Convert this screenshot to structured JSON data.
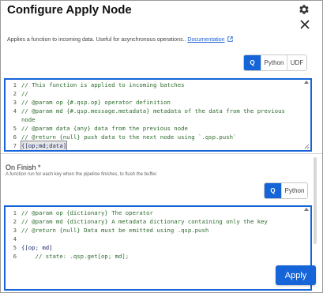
{
  "dialog": {
    "title": "Configure Apply Node",
    "description": "Applies a function to incoming data. Useful for asynchronous operations..",
    "doc_link": "Documentation"
  },
  "languages_top": [
    "Q",
    "Python",
    "UDF"
  ],
  "editor_top": {
    "lines": [
      {
        "n": "1",
        "text": "// This function is applied to incoming batches"
      },
      {
        "n": "2",
        "text": "//"
      },
      {
        "n": "3",
        "text": "// @param op {#.qsp.op} operator definition"
      },
      {
        "n": "4",
        "text": "// @param md {#.qsp.message.metadata} metadata of the data from the previous"
      },
      {
        "n": "",
        "text": "node"
      },
      {
        "n": "5",
        "text": "// @param data {any} data from the previous node"
      },
      {
        "n": "6",
        "text": "// @return {null} push data to the next node using `.qsp.push`"
      },
      {
        "n": "7",
        "text": "{[op;md;data]",
        "plain": true
      }
    ]
  },
  "on_finish": {
    "label": "On Finish *",
    "sublabel": "A function run for each key when the pipeline finishes, to flush the buffer."
  },
  "languages_bottom": [
    "Q",
    "Python"
  ],
  "editor_bottom": {
    "lines": [
      {
        "n": "1",
        "text": "// @param op {dictionary} The operator"
      },
      {
        "n": "2",
        "text": "// @param md {dictionary} A metadata dictionary containing only the key"
      },
      {
        "n": "3",
        "text": "// @return {null} Data must be emitted using .qsp.push"
      },
      {
        "n": "4",
        "text": ""
      },
      {
        "n": "5",
        "text": "{[op; md]",
        "plain": true
      },
      {
        "n": "6",
        "text": "    // state: .qsp.get[op; md];"
      }
    ]
  },
  "apply_label": "Apply",
  "colors": {
    "accent": "#1565d8",
    "comment": "#2d6b2d"
  },
  "icons": [
    "gear-icon",
    "close-icon",
    "external-link-icon"
  ]
}
